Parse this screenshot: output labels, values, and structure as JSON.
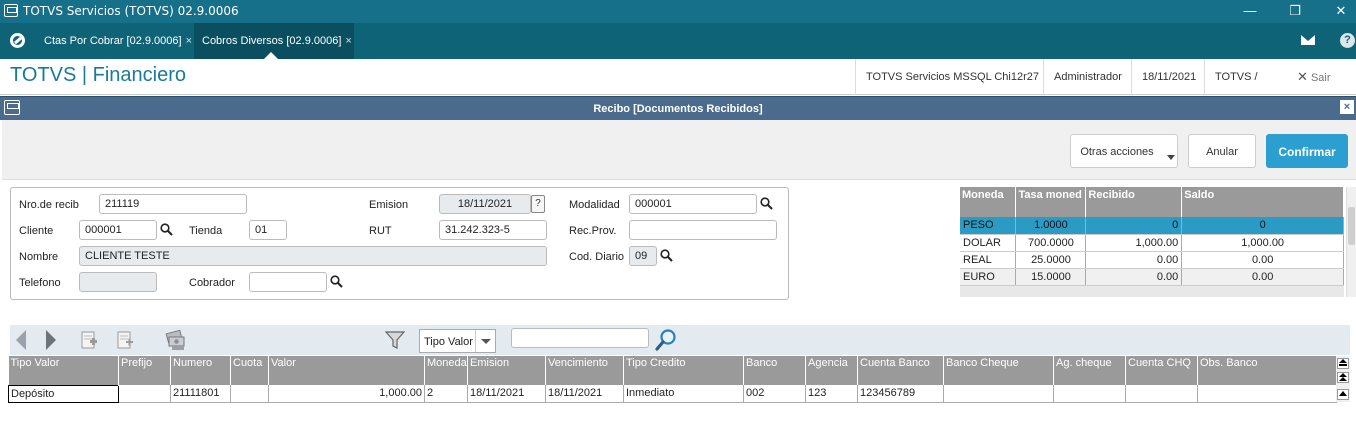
{
  "window": {
    "title": "TOTVS Servicios (TOTVS) 02.9.0006",
    "min": "—",
    "restore": "❐",
    "close": "✕"
  },
  "tabs": [
    {
      "label": "Ctas Por Cobrar [02.9.0006]",
      "close": "×"
    },
    {
      "label": "Cobros Diversos [02.9.0006]",
      "close": "×"
    }
  ],
  "header": {
    "brand": "TOTVS | Financiero",
    "environment": "TOTVS Servicios MSSQL Chi12r27",
    "user": "Administrador",
    "date": "18/11/2021",
    "company": "TOTVS / CHILE",
    "exit_icon": "✕",
    "exit_label": "Sair"
  },
  "dialog": {
    "title": "Recibo [Documentos Recibidos]",
    "close": "×",
    "actions": {
      "other": "Otras acciones",
      "cancel": "Anular",
      "confirm": "Confirmar"
    }
  },
  "form": {
    "nro_recib": {
      "label": "Nro.de recib",
      "value": "211119"
    },
    "emision": {
      "label": "Emision",
      "value": "18/11/2021",
      "help": "?"
    },
    "modalidad": {
      "label": "Modalidad",
      "value": "000001"
    },
    "cliente": {
      "label": "Cliente",
      "value": "000001"
    },
    "tienda": {
      "label": "Tienda",
      "value": "01"
    },
    "rut": {
      "label": "RUT",
      "value": "31.242.323-5"
    },
    "rec_prov": {
      "label": "Rec.Prov.",
      "value": ""
    },
    "nombre": {
      "label": "Nombre",
      "value": "CLIENTE TESTE"
    },
    "cod_diario": {
      "label": "Cod. Diario",
      "value": "09"
    },
    "telefono": {
      "label": "Telefono",
      "value": ""
    },
    "cobrador": {
      "label": "Cobrador",
      "value": ""
    }
  },
  "currency_table": {
    "headers": [
      "Moneda",
      "Tasa moned",
      "Recibido",
      "Saldo"
    ],
    "rows": [
      [
        "PESO",
        "1.0000",
        "0",
        "0"
      ],
      [
        "DOLAR",
        "700.0000",
        "1,000.00",
        "1,000.00"
      ],
      [
        "REAL",
        "25.0000",
        "0.00",
        "0.00"
      ],
      [
        "EURO",
        "15.0000",
        "0.00",
        "0.00"
      ]
    ]
  },
  "toolbar": {
    "filter_field": "Tipo Valor",
    "search_value": ""
  },
  "grid": {
    "headers": [
      "Tipo Valor",
      "Prefijo",
      "Numero",
      "Cuota",
      "Valor",
      "Moneda",
      "Emision",
      "Vencimiento",
      "Tipo Credito",
      "Banco",
      "Agencia",
      "Cuenta Banco",
      "Banco Cheque",
      "Ag. cheque",
      "Cuenta CHQ",
      "Obs. Banco"
    ],
    "rows": [
      [
        "Depósito",
        "",
        "21111801",
        "",
        "1,000.00",
        "2",
        "18/11/2021",
        "18/11/2021",
        "Inmediato",
        "002",
        "123",
        "123456789",
        "",
        "",
        "",
        ""
      ]
    ]
  },
  "colors": {
    "titlebar": "#17708a",
    "tabsbar": "#0f6376",
    "dialog": "#4a6b8c",
    "accent": "#2a9fd0",
    "selected_row": "#2a9bc4"
  }
}
